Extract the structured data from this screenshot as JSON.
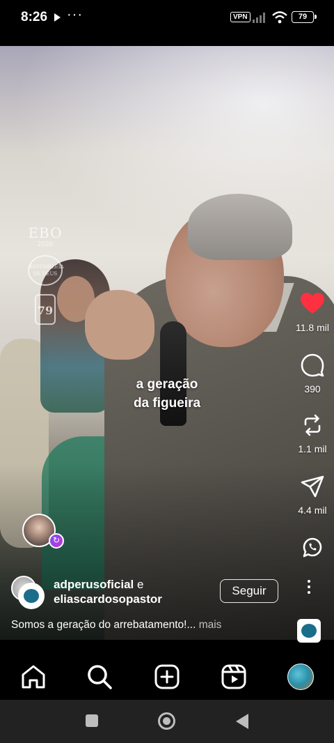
{
  "status_bar": {
    "time": "8:26",
    "dots": "···",
    "vpn": "VPN",
    "battery": "79"
  },
  "video": {
    "caption_line1": "a geração",
    "caption_line2": "da figueira",
    "watermark": {
      "title": "EBO",
      "subtitle": "2026",
      "badge": "ASSEMBLEIA DE DEUS",
      "years": "79"
    }
  },
  "actions": {
    "likes": "11.8 mil",
    "comments": "390",
    "reposts": "1.1 mil",
    "shares": "4.4 mil",
    "like_color": "#ff3040"
  },
  "post": {
    "author_primary": "adperusoficial",
    "author_connector": " e",
    "author_secondary": "eliascardosopastor",
    "follow_label": "Seguir",
    "description": "Somos a geração do arrebatamento!...",
    "more_label": " mais"
  },
  "bottom_nav": {
    "items": [
      "home-icon",
      "search-icon",
      "create-icon",
      "reels-icon",
      "profile-avatar"
    ]
  },
  "system_nav": {
    "items": [
      "recents-button",
      "home-button",
      "back-button"
    ]
  }
}
